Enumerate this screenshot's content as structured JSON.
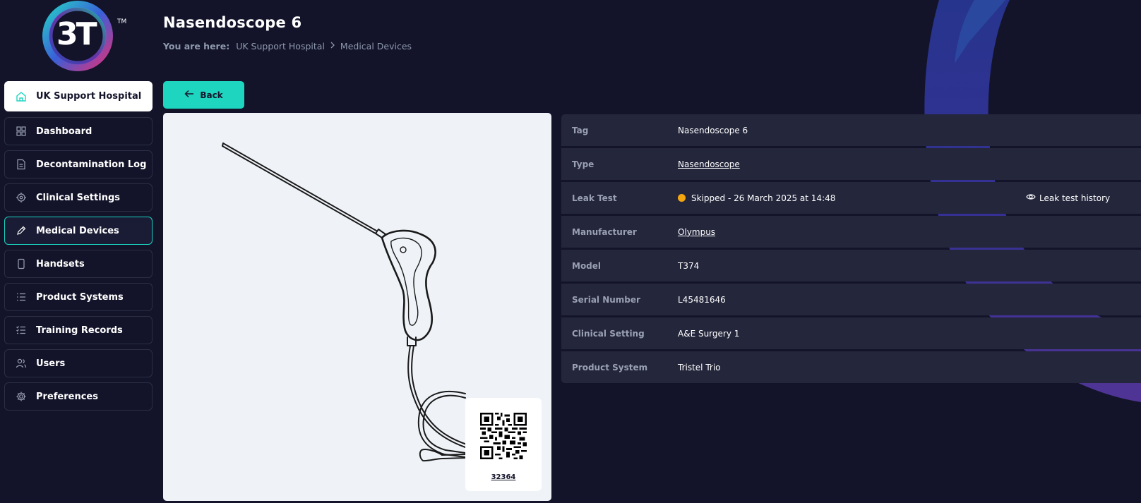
{
  "brand": {
    "logo_text": "3T",
    "trademark": "TM"
  },
  "header": {
    "title": "Nasendoscope 6",
    "breadcrumb": {
      "prefix": "You are here:",
      "items": [
        "UK Support Hospital",
        "Medical Devices"
      ]
    }
  },
  "sidebar": {
    "home": {
      "label": "UK Support Hospital",
      "icon": "home-icon"
    },
    "items": [
      {
        "label": "Dashboard",
        "icon": "dashboard-icon"
      },
      {
        "label": "Decontamination Log",
        "icon": "document-icon"
      },
      {
        "label": "Clinical Settings",
        "icon": "target-icon"
      },
      {
        "label": "Medical Devices",
        "icon": "pen-icon",
        "active": true
      },
      {
        "label": "Handsets",
        "icon": "phone-icon"
      },
      {
        "label": "Product Systems",
        "icon": "list-icon"
      },
      {
        "label": "Training Records",
        "icon": "checklist-icon"
      },
      {
        "label": "Users",
        "icon": "users-icon"
      },
      {
        "label": "Preferences",
        "icon": "gear-icon"
      }
    ]
  },
  "back_button": {
    "label": "Back"
  },
  "device": {
    "qr_code_number": "32364"
  },
  "details": {
    "tag": {
      "label": "Tag",
      "value": "Nasendoscope 6"
    },
    "type": {
      "label": "Type",
      "value": "Nasendoscope"
    },
    "leak_test": {
      "label": "Leak Test",
      "value": "Skipped - 26 March 2025 at 14:48",
      "status_color": "#f4a610",
      "history_label": "Leak test history"
    },
    "manufacturer": {
      "label": "Manufacturer",
      "value": "Olympus"
    },
    "model": {
      "label": "Model",
      "value": "T374"
    },
    "serial_number": {
      "label": "Serial Number",
      "value": "L45481646"
    },
    "clinical_setting": {
      "label": "Clinical Setting",
      "value": "A&E Surgery 1"
    },
    "product_system": {
      "label": "Product System",
      "value": "Tristel Trio"
    }
  },
  "colors": {
    "background": "#13142a",
    "accent": "#1ed6c0",
    "row_bg": "#24263c",
    "status_skipped": "#f4a610"
  }
}
